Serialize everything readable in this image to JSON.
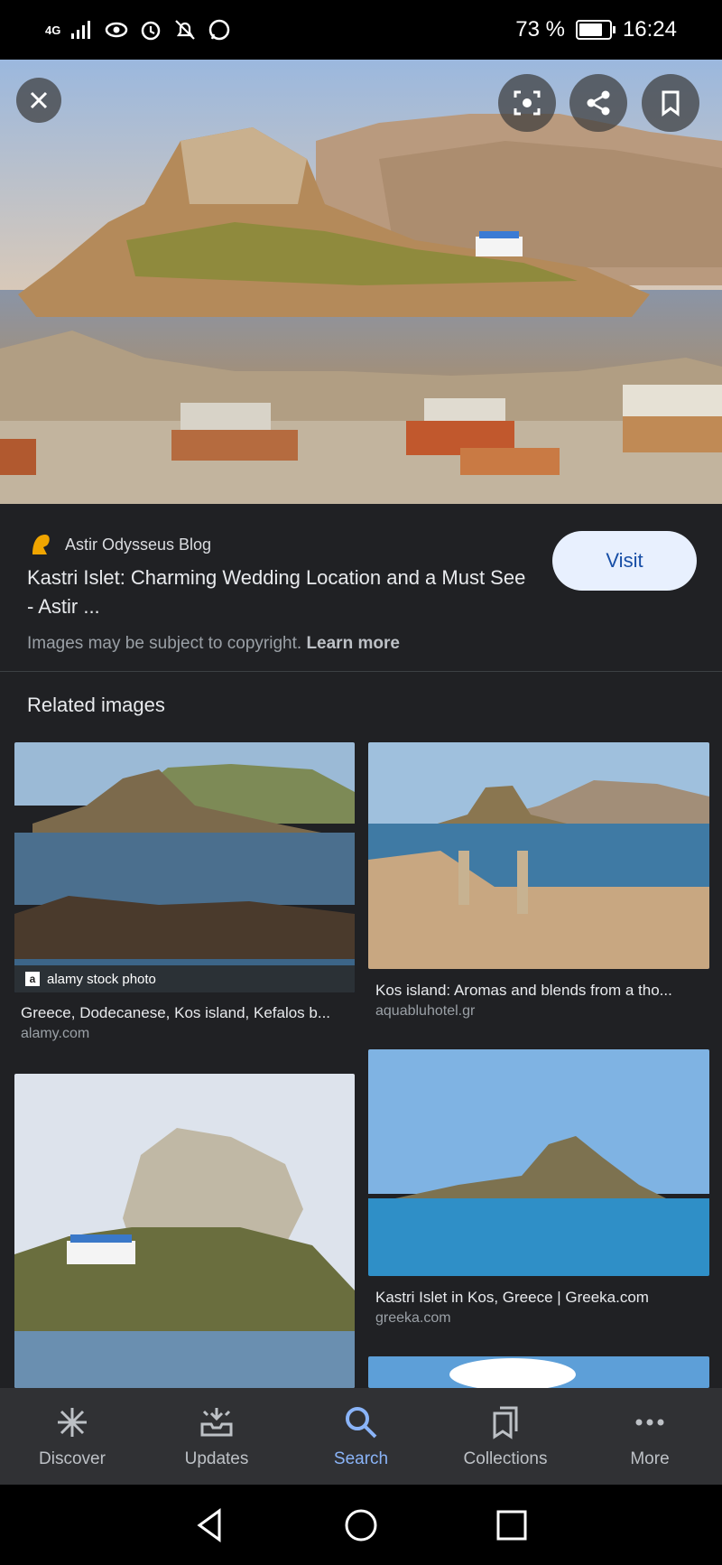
{
  "status_bar": {
    "signal": "4G",
    "battery": "73 %",
    "time": "16:24",
    "icons": [
      "signal-icon",
      "eye-comfort-icon",
      "alarm-icon",
      "mute-icon",
      "whatsapp-icon"
    ]
  },
  "hero": {
    "description_icons": [
      "close-icon",
      "lens-icon",
      "share-icon",
      "bookmark-icon"
    ]
  },
  "source": {
    "site_name": "Astir Odysseus Blog",
    "title": "Kastri Islet: Charming Wedding Location and a Must See - Astir ...",
    "copyright_text": "Images may be subject to copyright.",
    "learn_more": "Learn more",
    "visit_label": "Visit"
  },
  "related": {
    "heading": "Related images",
    "items": [
      {
        "caption": "Greece, Dodecanese, Kos island, Kefalos b...",
        "domain": "alamy.com",
        "watermark": "alamy stock photo"
      },
      {
        "caption": "Kos island: Aromas and blends from a tho...",
        "domain": "aquabluhotel.gr"
      },
      {
        "caption": "",
        "domain": ""
      },
      {
        "caption": "Kastri Islet in Kos, Greece | Greeka.com",
        "domain": "greeka.com"
      }
    ]
  },
  "bottom_nav": {
    "items": [
      {
        "label": "Discover",
        "icon": "asterisk-icon"
      },
      {
        "label": "Updates",
        "icon": "inbox-icon"
      },
      {
        "label": "Search",
        "icon": "search-icon",
        "active": true
      },
      {
        "label": "Collections",
        "icon": "collections-icon"
      },
      {
        "label": "More",
        "icon": "more-icon"
      }
    ]
  },
  "colors": {
    "background": "#202124",
    "accent": "#8ab4f8",
    "visit_bg": "#e8f0fe",
    "visit_text": "#174ea6"
  }
}
